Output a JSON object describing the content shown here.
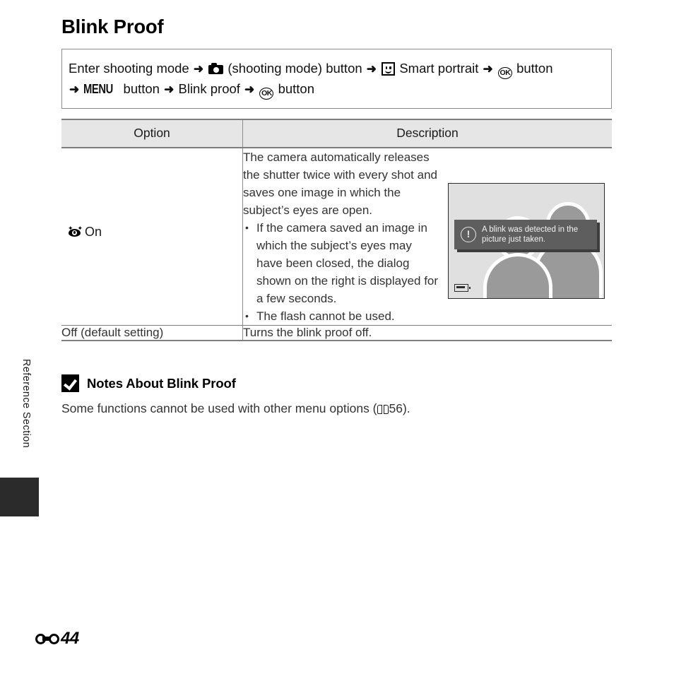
{
  "page": {
    "title": "Blink Proof",
    "side_tab_label": "Reference Section",
    "page_number": "44",
    "page_section_glyph": "reference-section-glyph"
  },
  "nav_path": {
    "line1": {
      "seg1": "Enter shooting mode",
      "arrow1": "➜",
      "icon1": "camera-icon",
      "seg2": "(shooting mode) button",
      "arrow2": "➜",
      "icon2": "smiley-face-icon",
      "seg3": "Smart portrait",
      "arrow3": "➜",
      "icon3": "ok-button-icon",
      "icon3_label": "OK",
      "seg4": "button"
    },
    "line2": {
      "arrow1": "➜",
      "menu_label": "MENU",
      "seg1": "button",
      "arrow2": "➜",
      "seg2": "Blink proof",
      "arrow3": "➜",
      "icon1": "ok-button-icon",
      "icon1_label": "OK",
      "seg3": "button"
    }
  },
  "table": {
    "headers": {
      "option": "Option",
      "description": "Description"
    },
    "rows": [
      {
        "option_icon": "blink-proof-eye-icon",
        "option_label": "On",
        "description_intro": "The camera automatically releases the shutter twice with every shot and saves one image in which the subject’s eyes are open.",
        "description_bullets": [
          "If the camera saved an image in which the subject’s eyes may have been closed, the dialog shown on the right is displayed for a few seconds.",
          "The flash cannot be used."
        ],
        "illustration": {
          "name": "camera-monitor-illustration",
          "dialog_text": "A blink was detected in the picture just taken.",
          "dialog_icon": "exclamation-icon",
          "battery_icon": "battery-icon",
          "subjects": [
            "person-silhouette-front",
            "person-silhouette-back"
          ]
        }
      },
      {
        "option_label": "Off (default setting)",
        "description": "Turns the blink proof off."
      }
    ]
  },
  "notes": {
    "icon": "caution-check-icon",
    "title": "Notes About Blink Proof",
    "body_before": "Some functions cannot be used with other menu options (",
    "ref_icon": "book-reference-icon",
    "ref_page": "56",
    "body_after": ")."
  },
  "colors": {
    "header_bg": "#e6e6e6",
    "rule": "#7d7d7d",
    "screen_bg": "#e0e0e0",
    "silhouette": "#9a9a9a",
    "dialog_bg": "#5e5e5e",
    "tab_marker": "#2b2b2b"
  }
}
